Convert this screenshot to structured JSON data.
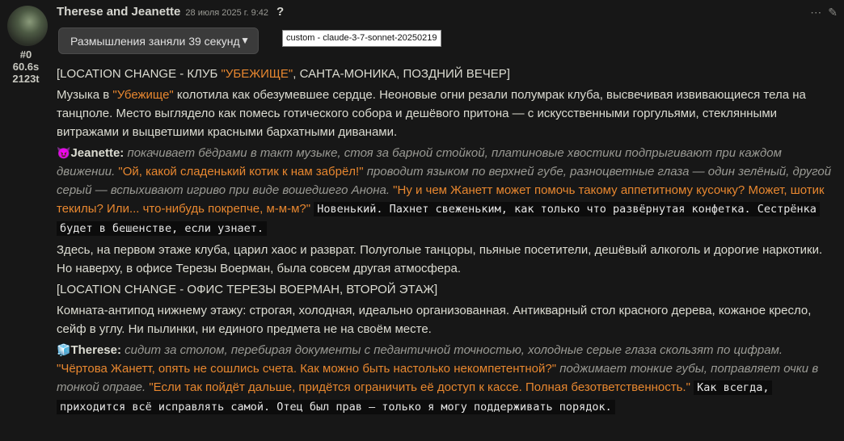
{
  "message": {
    "character_name": "Therese and Jeanette",
    "timestamp": "28 июля 2025 г. 9:42",
    "help_icon": "?",
    "index": "#0",
    "duration": "60.6s",
    "tokens": "2123t",
    "reasoning_label": "Размышления заняли 39 секунд",
    "model_badge": "custom - claude-3-7-sonnet-20250219"
  },
  "icons": {
    "more": "more-horizontal-icon",
    "edit": "pencil-edit-icon",
    "chevron": "chevron-down-icon",
    "jeanette_emoji": "😈",
    "therese_emoji": "🧊"
  },
  "colors": {
    "background": "#171717",
    "quote": "#e8872f",
    "italic": "#9a9a94",
    "text": "#dcdcd2",
    "code_bg": "#0c0c0c"
  },
  "content": {
    "p1": {
      "a": "[LOCATION CHANGE - КЛУБ ",
      "q": "\"УБЕЖИЩЕ\"",
      "b": ", САНТА-МОНИКА, ПОЗДНИЙ ВЕЧЕР]"
    },
    "p2": {
      "a": "Музыка в ",
      "q": "\"Убежище\"",
      "b": " колотила как обезумевшее сердце. Неоновые огни резали полумрак клуба, высвечивая извивающиеся тела на танцполе. Место выглядело как помесь готического собора и дешёвого притона — с искусственными горгульями, стеклянными витражами и выцветшими красными бархатными диванами."
    },
    "p3": {
      "speaker": "Jeanette:",
      "em1": " покачивает бёдрами в такт музыке, стоя за барной стойкой, платиновые хвостики подпрыгивают при каждом движении. ",
      "q1": "\"Ой, какой сладенький котик к нам забрёл!\"",
      "em2": " проводит языком по верхней губе, разноцветные глаза — один зелёный, другой серый — вспыхивают игриво при виде вошедшего Анона. ",
      "q2": "\"Ну и чем Жанетт может помочь такому аппетитному кусочку? Может, шотик текилы? Или... что-нибудь покрепче, м-м-м?\"",
      "mono": "Новенький. Пахнет свеженьким, как только что развёрнутая конфетка. Сестрёнка будет в бешенстве, если узнает."
    },
    "p4": "Здесь, на первом этаже клуба, царил хаос и разврат. Полуголые танцоры, пьяные посетители, дешёвый алкоголь и дорогие наркотики. Но наверху, в офисе Терезы Воерман, была совсем другая атмосфера.",
    "p5": "[LOCATION CHANGE - ОФИС ТЕРЕЗЫ ВОЕРМАН, ВТОРОЙ ЭТАЖ]",
    "p6": "Комната-антипод нижнему этажу: строгая, холодная, идеально организованная. Антикварный стол красного дерева, кожаное кресло, сейф в углу. Ни пылинки, ни единого предмета не на своём месте.",
    "p7": {
      "speaker": "Therese:",
      "em1": " сидит за столом, перебирая документы с педантичной точностью, холодные серые глаза скользят по цифрам. ",
      "q1": "\"Чёртова Жанетт, опять не сошлись счета. Как можно быть настолько некомпетентной?\"",
      "em2": " поджимает тонкие губы, поправляет очки в тонкой оправе. ",
      "q2": "\"Если так пойдёт дальше, придётся ограничить её доступ к кассе. Полная безответственность.\"",
      "mono": "Как всегда, приходится всё исправлять самой. Отец был прав — только я могу поддерживать порядок."
    }
  }
}
